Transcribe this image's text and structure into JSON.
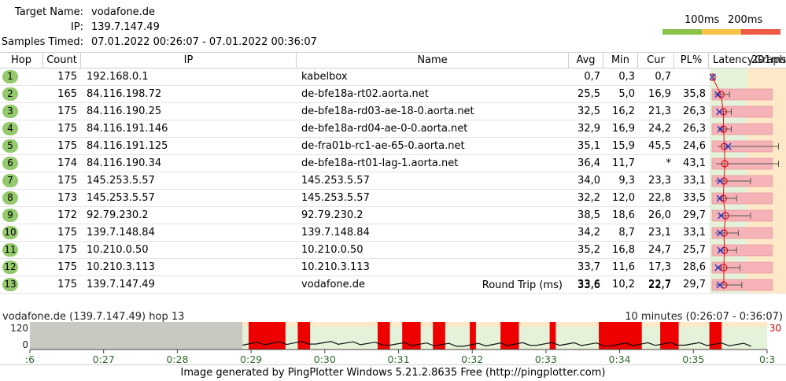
{
  "header": {
    "target_label": "Target Name:",
    "target_value": "vodafone.de",
    "ip_label": "IP:",
    "ip_value": "139.7.147.49",
    "samples_label": "Samples Timed:",
    "samples_value": "07.01.2022 00:26:07 - 07.01.2022 00:36:07",
    "scale_100": "100ms",
    "scale_200": "200ms",
    "scale_colors": [
      "#8bc34a",
      "#f7c14b",
      "#ef5a45"
    ]
  },
  "columns": {
    "hop": "Hop",
    "count": "Count",
    "ip": "IP",
    "name": "Name",
    "avg": "Avg",
    "min": "Min",
    "cur": "Cur",
    "pl": "PL%",
    "latency": "Latency",
    "overlap_a": "201ms",
    "overlap_b": "Graph"
  },
  "hops": [
    {
      "hop": "1",
      "count": "175",
      "ip": "192.168.0.1",
      "name": "kabelbox",
      "avg": "0,7",
      "min": "0,3",
      "cur": "0,7",
      "pl": "",
      "pl_value": 0,
      "avg_ms": 0.7,
      "min_ms": 0.3,
      "max_ms": 2.0,
      "cur_ms": 0.7
    },
    {
      "hop": "2",
      "count": "165",
      "ip": "84.116.198.72",
      "name": "de-bfe18a-rt02.aorta.net",
      "avg": "25,5",
      "min": "5,0",
      "cur": "16,9",
      "pl": "35,8",
      "pl_value": 35.8,
      "avg_ms": 25.5,
      "min_ms": 5.0,
      "max_ms": 50.0,
      "cur_ms": 16.9
    },
    {
      "hop": "3",
      "count": "175",
      "ip": "84.116.190.25",
      "name": "de-bfe18a-rd03-ae-18-0.aorta.net",
      "avg": "32,5",
      "min": "16,2",
      "cur": "21,3",
      "pl": "26,3",
      "pl_value": 26.3,
      "avg_ms": 32.5,
      "min_ms": 16.2,
      "max_ms": 55.0,
      "cur_ms": 21.3
    },
    {
      "hop": "4",
      "count": "175",
      "ip": "84.116.191.146",
      "name": "de-bfe18a-rd04-ae-0-0.aorta.net",
      "avg": "32,9",
      "min": "16,9",
      "cur": "24,2",
      "pl": "26,3",
      "pl_value": 26.3,
      "avg_ms": 32.9,
      "min_ms": 16.9,
      "max_ms": 55.0,
      "cur_ms": 24.2
    },
    {
      "hop": "5",
      "count": "175",
      "ip": "84.116.191.125",
      "name": "de-fra01b-rc1-ae-65-0.aorta.net",
      "avg": "35,1",
      "min": "15,9",
      "cur": "45,5",
      "pl": "24,6",
      "pl_value": 24.6,
      "avg_ms": 35.1,
      "min_ms": 15.9,
      "max_ms": 190.0,
      "cur_ms": 45.5
    },
    {
      "hop": "6",
      "count": "174",
      "ip": "84.116.190.34",
      "name": "de-bfe18a-rt01-lag-1.aorta.net",
      "avg": "36,4",
      "min": "11,7",
      "cur": "*",
      "pl": "43,1",
      "pl_value": 43.1,
      "avg_ms": 36.4,
      "min_ms": 11.7,
      "max_ms": 190.0,
      "cur_ms": null
    },
    {
      "hop": "7",
      "count": "175",
      "ip": "145.253.5.57",
      "name": "145.253.5.57",
      "avg": "34,0",
      "min": "9,3",
      "cur": "23,3",
      "pl": "33,1",
      "pl_value": 33.1,
      "avg_ms": 34.0,
      "min_ms": 9.3,
      "max_ms": 110.0,
      "cur_ms": 23.3
    },
    {
      "hop": "8",
      "count": "173",
      "ip": "145.253.5.57",
      "name": "145.253.5.57",
      "avg": "32,2",
      "min": "12,0",
      "cur": "22,8",
      "pl": "33,5",
      "pl_value": 33.5,
      "avg_ms": 32.2,
      "min_ms": 12.0,
      "max_ms": 70.0,
      "cur_ms": 22.8
    },
    {
      "hop": "9",
      "count": "172",
      "ip": "92.79.230.2",
      "name": "92.79.230.2",
      "avg": "38,5",
      "min": "18,6",
      "cur": "26,0",
      "pl": "29,7",
      "pl_value": 29.7,
      "avg_ms": 38.5,
      "min_ms": 18.6,
      "max_ms": 110.0,
      "cur_ms": 26.0
    },
    {
      "hop": "10",
      "count": "175",
      "ip": "139.7.148.84",
      "name": "139.7.148.84",
      "avg": "34,2",
      "min": "8,7",
      "cur": "23,1",
      "pl": "33,1",
      "pl_value": 33.1,
      "avg_ms": 34.2,
      "min_ms": 8.7,
      "max_ms": 75.0,
      "cur_ms": 23.1
    },
    {
      "hop": "11",
      "count": "175",
      "ip": "10.210.0.50",
      "name": "10.210.0.50",
      "avg": "35,2",
      "min": "16,8",
      "cur": "24,7",
      "pl": "25,7",
      "pl_value": 25.7,
      "avg_ms": 35.2,
      "min_ms": 16.8,
      "max_ms": 70.0,
      "cur_ms": 24.7
    },
    {
      "hop": "12",
      "count": "175",
      "ip": "10.210.3.113",
      "name": "10.210.3.113",
      "avg": "33,7",
      "min": "11,6",
      "cur": "17,3",
      "pl": "28,6",
      "pl_value": 28.6,
      "avg_ms": 33.7,
      "min_ms": 11.6,
      "max_ms": 80.0,
      "cur_ms": 17.3
    },
    {
      "hop": "13",
      "count": "175",
      "ip": "139.7.147.49",
      "name": "vodafone.de",
      "avg": "33,6",
      "min": "10,2",
      "cur": "22,7",
      "pl": "29,7",
      "pl_value": 29.7,
      "avg_ms": 33.6,
      "min_ms": 10.2,
      "max_ms": 85.0,
      "cur_ms": 22.7
    }
  ],
  "round_trip": {
    "label": "Round Trip (ms)",
    "avg": "33,6",
    "cur": "22,7"
  },
  "timeline": {
    "title": "vodafone.de (139.7.147.49) hop 13",
    "range": "10 minutes (0:26:07 - 0:36:07)",
    "y_top": "120",
    "y_bottom": "0",
    "right_value": "30",
    "ticks": [
      ":6",
      "0:27",
      "0:28",
      "0:29",
      "0:30",
      "0:31",
      "0:32",
      "0:33",
      "0:34",
      "0:35",
      "0:3"
    ]
  },
  "footer": "Image generated by PingPlotter Windows 5.21.2.8635 Free (http://pingplotter.com)",
  "chart_data": {
    "type": "line",
    "title": "vodafone.de (139.7.147.49) hop 13",
    "xlabel": "",
    "ylabel": "",
    "ylim": [
      0,
      120
    ],
    "x": [
      "0:29",
      "0:30",
      "0:31",
      "0:32",
      "0:33",
      "0:34",
      "0:35",
      "0:36"
    ],
    "series": [
      {
        "values": [
          25,
          30,
          25,
          20,
          25,
          22,
          25,
          20
        ]
      }
    ],
    "loss_bands": [
      {
        "start": "0:29:05",
        "end": "0:29:35"
      },
      {
        "start": "0:29:45",
        "end": "0:29:55"
      },
      {
        "start": "0:30:50",
        "end": "0:31:00"
      },
      {
        "start": "0:31:10",
        "end": "0:31:25"
      },
      {
        "start": "0:31:35",
        "end": "0:31:45"
      },
      {
        "start": "0:32:05",
        "end": "0:32:10"
      },
      {
        "start": "0:32:30",
        "end": "0:32:45"
      },
      {
        "start": "0:33:10",
        "end": "0:33:15"
      },
      {
        "start": "0:33:50",
        "end": "0:34:25"
      },
      {
        "start": "0:34:40",
        "end": "0:34:55"
      },
      {
        "start": "0:35:20",
        "end": "0:35:30"
      }
    ]
  }
}
